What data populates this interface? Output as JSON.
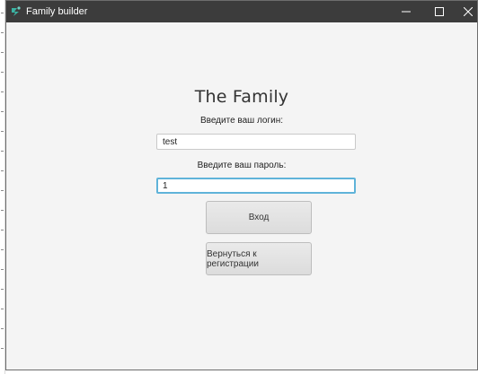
{
  "window": {
    "title": "Family builder",
    "controls": {
      "minimize_icon": "minimize-icon",
      "maximize_icon": "maximize-icon",
      "close_icon": "close-icon"
    },
    "titlebar_color": "#3c3c3c",
    "accent_color": "#5fb3d9"
  },
  "form": {
    "heading": "The Family",
    "login_label": "Введите ваш логин:",
    "login_value": "test",
    "password_label": "Введите ваш пароль:",
    "password_value": "1",
    "login_button": "Вход",
    "register_button": "Вернуться к регистрации"
  }
}
